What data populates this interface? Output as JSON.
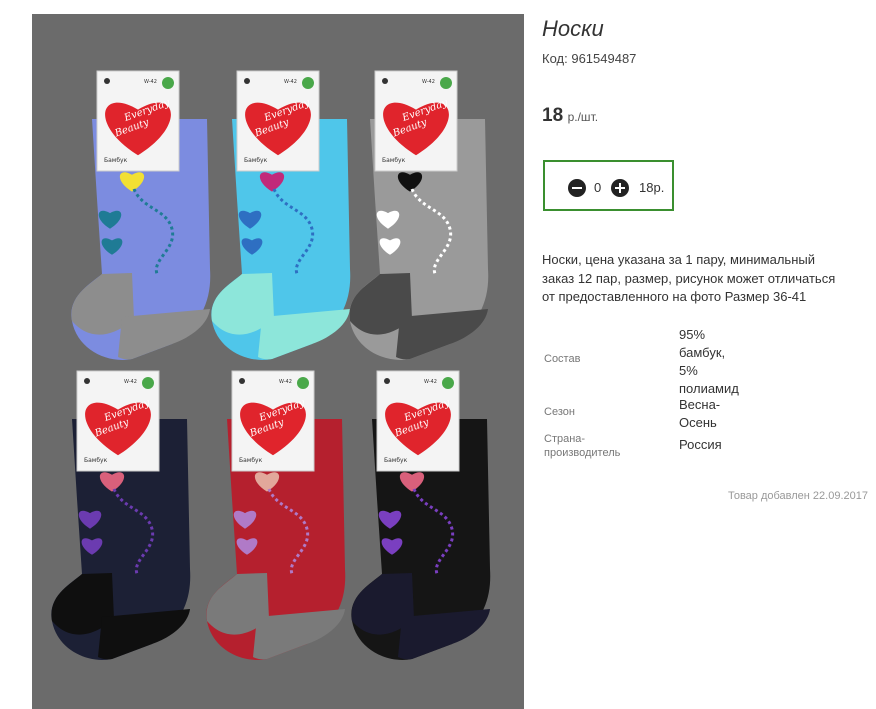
{
  "product": {
    "title": "Носки",
    "code_label": "Код:",
    "code": "961549487",
    "price": "18",
    "price_unit": "р./шт.",
    "image_alt": "Носки Everyday Beauty бамбук, 6 пар"
  },
  "quantity": {
    "value": "0",
    "sum": "18р."
  },
  "description": "Носки, цена указана за 1 пару, минимальный заказ 12 пар, размер, рисунок может отличаться от предоставленного на фото Размер 36-41",
  "properties": [
    {
      "key_lines": [
        "Состав"
      ],
      "value_lines": [
        "95%",
        "бамбук,",
        "5%",
        "полиамид"
      ]
    },
    {
      "key_lines": [
        "Сезон"
      ],
      "value_lines": [
        "Весна-",
        "Осень"
      ]
    },
    {
      "key_lines": [
        "Страна-",
        "производитель"
      ],
      "value_lines": [
        "Россия"
      ]
    }
  ],
  "added": "Товар добавлен 22.09.2017",
  "photo": {
    "tag_brand_lines": [
      "Everyday",
      "Beauty"
    ],
    "tag_material": "Бамбук",
    "tag_size": "W-42",
    "sock_colors": [
      "#7c8ce0",
      "#4fc6ea",
      "#9a9a9a",
      "#1c2035",
      "#b5202e",
      "#151515"
    ],
    "heel_colors": [
      "#8d8d8d",
      "#8de6da",
      "#4a4a4a",
      "#0f0f0f",
      "#7a7a7a",
      "#1a1a2e"
    ],
    "heart_colors": [
      [
        "#f2e033",
        "#1f7b95",
        "#1f7b95"
      ],
      [
        "#c2297a",
        "#2e6fc2",
        "#2e6fc2"
      ],
      [
        "#111111",
        "#ffffff",
        "#ffffff"
      ],
      [
        "#d9607b",
        "#6b3bb0",
        "#6b3bb0"
      ],
      [
        "#e2a89b",
        "#b07ac7",
        "#b07ac7"
      ],
      [
        "#d9607b",
        "#7a3fc0",
        "#7a3fc0"
      ]
    ],
    "background": "#6b6b6b",
    "heart_tag": "#e0242c"
  }
}
